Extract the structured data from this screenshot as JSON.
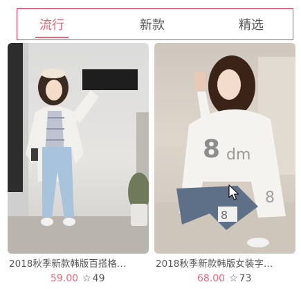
{
  "tabs": [
    {
      "label": "流行",
      "active": true
    },
    {
      "label": "新款",
      "active": false
    },
    {
      "label": "精选",
      "active": false
    }
  ],
  "products": [
    {
      "title": "2018秋季新款韩版百搭格…",
      "price": "59.00",
      "likes": "49",
      "image": "model-white-jacket-jeans"
    },
    {
      "title": "2018秋季新款韩版女装字…",
      "price": "68.00",
      "likes": "73",
      "image": "model-white-hoodie-selfie"
    }
  ],
  "colors": {
    "accent": "#f06478",
    "tab_border": "#e53a52",
    "text": "#555555"
  },
  "icons": {
    "likes": "star-outline-icon"
  }
}
